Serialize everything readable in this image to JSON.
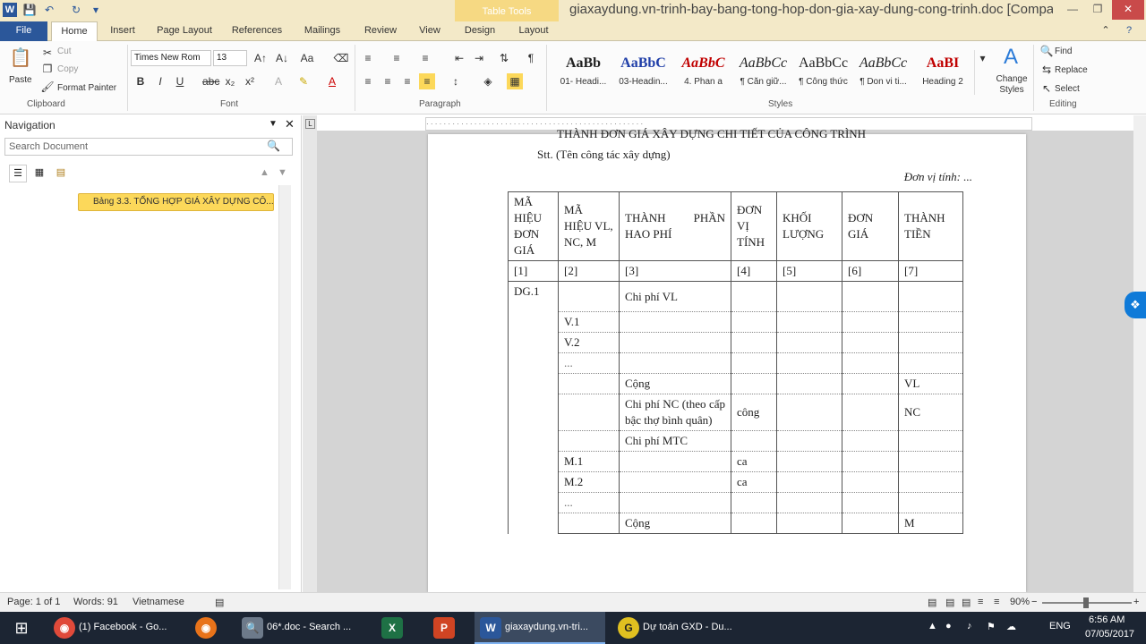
{
  "title_bar": {
    "app_icon": "W",
    "contextual_tab_group": "Table Tools",
    "document_title": "giaxaydung.vn-trinh-bay-bang-tong-hop-don-gia-xay-dung-cong-trinh.doc [Compat..."
  },
  "tabs": [
    "File",
    "Home",
    "Insert",
    "Page Layout",
    "References",
    "Mailings",
    "Review",
    "View",
    "Design",
    "Layout"
  ],
  "ribbon": {
    "clipboard": {
      "paste": "Paste",
      "cut": "Cut",
      "copy": "Copy",
      "format_painter": "Format Painter",
      "label": "Clipboard"
    },
    "font": {
      "name": "Times New Rom",
      "size": "13",
      "label": "Font"
    },
    "paragraph": {
      "label": "Paragraph"
    },
    "styles": {
      "label": "Styles",
      "items": [
        {
          "sample": "AaBb",
          "name": "01- Headi..."
        },
        {
          "sample": "AaBbC",
          "name": "03-Headin..."
        },
        {
          "sample": "AaBbC",
          "name": "4. Phan a"
        },
        {
          "sample": "AaBbCc",
          "name": "¶ Căn giữ..."
        },
        {
          "sample": "AaBbCc",
          "name": "¶ Công thức"
        },
        {
          "sample": "AaBbCc",
          "name": "¶ Don vi ti..."
        },
        {
          "sample": "AaBI",
          "name": "Heading 2"
        }
      ],
      "change_styles": "Change Styles"
    },
    "editing": {
      "find": "Find",
      "replace": "Replace",
      "select": "Select",
      "label": "Editing"
    }
  },
  "navigation": {
    "title": "Navigation",
    "search_placeholder": "Search Document",
    "heading_item": "Bảng 3.3. TỔNG HỢP GIÁ XÂY DỰNG CÔ..."
  },
  "document": {
    "clipped_heading": "THÀNH ĐƠN GIÁ XÂY DỰNG CHI TIẾT CỦA CÔNG TRÌNH",
    "stt_line": "Stt. (Tên công tác xây dựng)",
    "unit_line": "Đơn vị tính: ...",
    "table": {
      "headers": [
        "MÃ HIỆU ĐƠN GIÁ",
        "MÃ HIỆU VL, NC, M",
        "THÀNH PHẦN HAO PHÍ",
        "ĐƠN VỊ TÍNH",
        "KHỐI LƯỢNG",
        "ĐƠN GIÁ",
        "THÀNH TIỀN"
      ],
      "index_row": [
        "[1]",
        "[2]",
        "[3]",
        "[4]",
        "[5]",
        "[6]",
        "[7]"
      ],
      "rows": [
        [
          "DG.1",
          "",
          "Chi phí VL",
          "",
          "",
          "",
          ""
        ],
        [
          "",
          "V.1",
          "",
          "",
          "",
          "",
          ""
        ],
        [
          "",
          "V.2",
          "",
          "",
          "",
          "",
          ""
        ],
        [
          "",
          "...",
          "",
          "",
          "",
          "",
          ""
        ],
        [
          "",
          "",
          "Cộng",
          "",
          "",
          "",
          "VL"
        ],
        [
          "",
          "",
          "Chi phí NC (theo cấp bậc thợ bình quân)",
          "công",
          "",
          "",
          "NC"
        ],
        [
          "",
          "",
          "Chi phí MTC",
          "",
          "",
          "",
          ""
        ],
        [
          "",
          "M.1",
          "",
          "ca",
          "",
          "",
          ""
        ],
        [
          "",
          "M.2",
          "",
          "ca",
          "",
          "",
          ""
        ],
        [
          "",
          "...",
          "",
          "",
          "",
          "",
          ""
        ],
        [
          "",
          "",
          "Cộng",
          "",
          "",
          "",
          "M"
        ]
      ]
    }
  },
  "status_bar": {
    "page": "Page: 1 of 1",
    "words": "Words: 91",
    "language": "Vietnamese",
    "zoom": "90%"
  },
  "taskbar": {
    "items": [
      {
        "label": "(1) Facebook - Go...",
        "icon": "chrome-icon",
        "color": "#e04a3a"
      },
      {
        "label": "",
        "icon": "firefox-icon",
        "color": "#e8731a"
      },
      {
        "label": "06*.doc - Search ...",
        "icon": "search-icon",
        "color": "#6d7a8a"
      },
      {
        "label": "",
        "icon": "excel-icon",
        "color": "#1e7145"
      },
      {
        "label": "",
        "icon": "powerpoint-icon",
        "color": "#d04423"
      },
      {
        "label": "giaxaydung.vn-tri...",
        "icon": "word-icon",
        "color": "#2b579a"
      },
      {
        "label": "Dự toán GXD - Du...",
        "icon": "gxd-icon",
        "color": "#e0c020"
      }
    ],
    "tray_lang": "ENG",
    "time": "6:56 AM",
    "date": "07/05/2017"
  }
}
